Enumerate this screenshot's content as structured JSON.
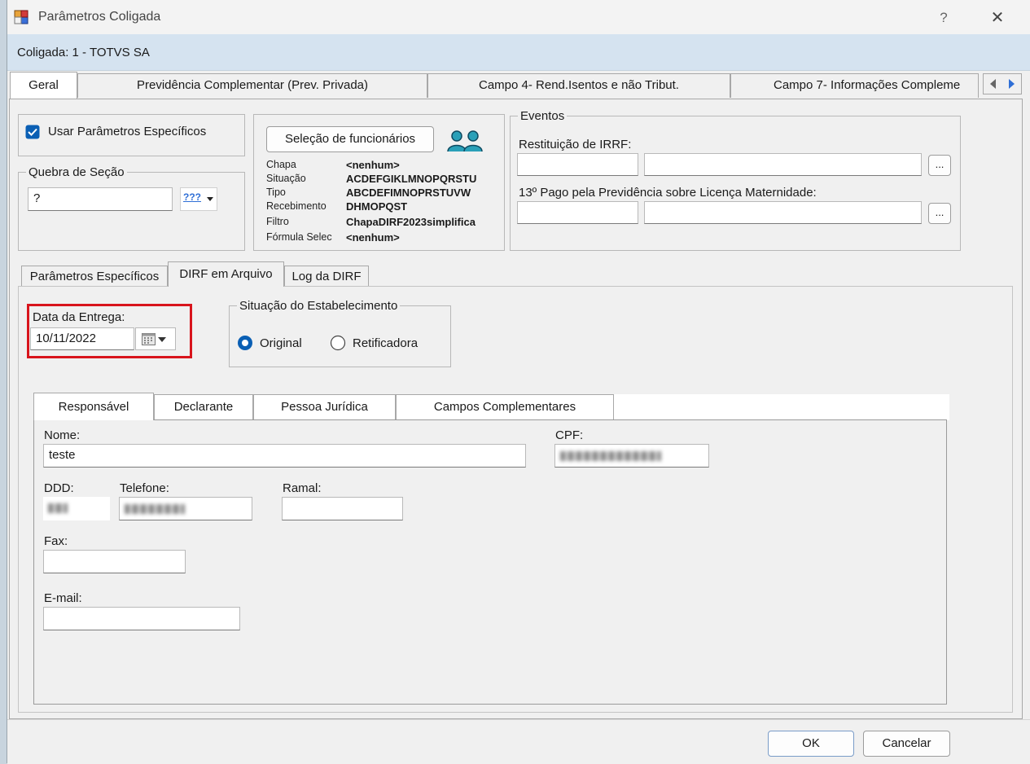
{
  "window": {
    "title": "Parâmetros Coligada",
    "help": "?",
    "close": "✕"
  },
  "banner": {
    "text": "Coligada: 1 - TOTVS SA"
  },
  "top_tabs": [
    "Geral",
    "Previdência Complementar (Prev. Privada)",
    "Campo 4- Rend.Isentos e não Tribut.",
    "Campo 7- Informações Compleme"
  ],
  "usar": {
    "label": "Usar Parâmetros Específicos",
    "checked": true
  },
  "quebra": {
    "legend": "Quebra de Seção",
    "value": "?",
    "lookup": "???"
  },
  "selecao": {
    "button": "Seleção de funcionários",
    "rows": [
      {
        "key": "Chapa",
        "value": "<nenhum>"
      },
      {
        "key": "Situação",
        "value": "ACDEFGIKLMNOPQRSTU"
      },
      {
        "key": "Tipo",
        "value": "ABCDEFIMNOPRSTUVW"
      },
      {
        "key": "Recebimento",
        "value": "DHMOPQST"
      },
      {
        "key": "Filtro",
        "value": "ChapaDIRF2023simplifica"
      },
      {
        "key": "Fórmula Selec",
        "value": "<nenhum>"
      }
    ]
  },
  "eventos": {
    "legend": "Eventos",
    "restituicao": "Restituição de IRRF:",
    "decimo": "13º Pago pela Previdência sobre Licença Maternidade:",
    "ellipsis": "..."
  },
  "sub_tabs": [
    "Parâmetros Específicos",
    "DIRF em Arquivo",
    "Log da DIRF"
  ],
  "entrega": {
    "label": "Data da Entrega:",
    "value": "10/11/2022"
  },
  "situacao": {
    "legend": "Situação do Estabelecimento",
    "original": "Original",
    "retificadora": "Retificadora",
    "selected": "Original"
  },
  "inner_tabs": [
    "Responsável",
    "Declarante",
    "Pessoa Jurídica",
    "Campos Complementares"
  ],
  "responsavel": {
    "nome_label": "Nome:",
    "nome_value": "teste",
    "cpf_label": "CPF:",
    "ddd_label": "DDD:",
    "telefone_label": "Telefone:",
    "ramal_label": "Ramal:",
    "fax_label": "Fax:",
    "email_label": "E-mail:"
  },
  "footer": {
    "ok": "OK",
    "cancel": "Cancelar"
  },
  "colors": {
    "highlight": "#d8141c",
    "accent": "#0a5fb4",
    "banner": "#d5e3f0"
  }
}
